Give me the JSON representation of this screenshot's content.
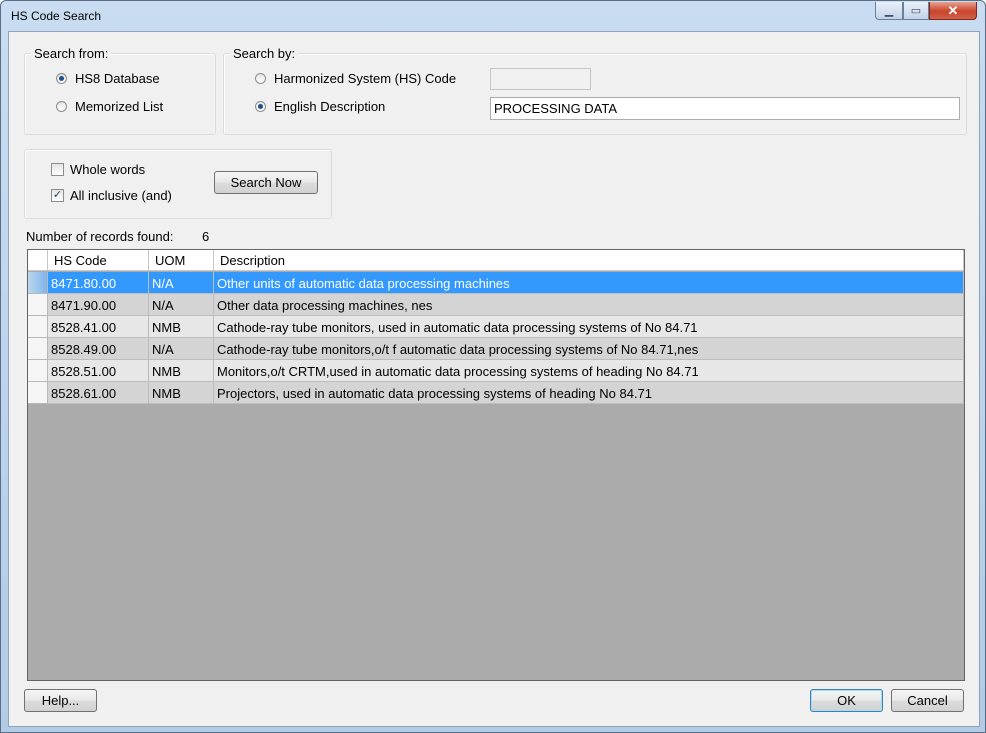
{
  "window": {
    "title": "HS Code Search"
  },
  "search_from": {
    "label": "Search from:",
    "options": [
      {
        "label": "HS8 Database",
        "selected": true
      },
      {
        "label": "Memorized List",
        "selected": false
      }
    ]
  },
  "search_by": {
    "label": "Search by:",
    "hs_code": {
      "label": "Harmonized System (HS) Code",
      "selected": false,
      "value": ""
    },
    "english": {
      "label": "English Description",
      "selected": true,
      "value": "PROCESSING DATA"
    }
  },
  "options": {
    "whole_words": {
      "label": "Whole words",
      "checked": false
    },
    "all_inclusive": {
      "label": "All inclusive (and)",
      "checked": true
    },
    "search_button": "Search Now"
  },
  "records": {
    "label": "Number of records found:",
    "count": "6"
  },
  "table": {
    "columns": [
      "HS Code",
      "UOM",
      "Description"
    ],
    "rows": [
      {
        "code": "8471.80.00",
        "uom": "N/A",
        "desc": "Other units of automatic data processing machines"
      },
      {
        "code": "8471.90.00",
        "uom": "N/A",
        "desc": "Other data processing machines, nes"
      },
      {
        "code": "8528.41.00",
        "uom": "NMB",
        "desc": "Cathode-ray tube monitors, used in automatic data processing systems of No 84.71"
      },
      {
        "code": "8528.49.00",
        "uom": "N/A",
        "desc": "Cathode-ray tube monitors,o/t f automatic data processing systems of No 84.71,nes"
      },
      {
        "code": "8528.51.00",
        "uom": "NMB",
        "desc": "Monitors,o/t CRTM,used in automatic data processing systems of heading No 84.71"
      },
      {
        "code": "8528.61.00",
        "uom": "NMB",
        "desc": "Projectors, used in automatic data processing systems of heading No 84.71"
      }
    ]
  },
  "buttons": {
    "help": "Help...",
    "ok": "OK",
    "cancel": "Cancel"
  },
  "colors": {
    "selection": "#3399ff",
    "grid_background": "#ababab"
  }
}
